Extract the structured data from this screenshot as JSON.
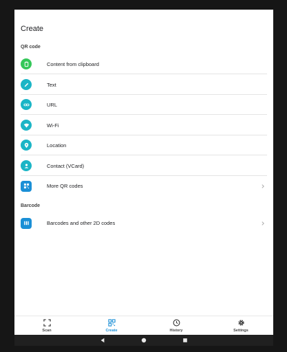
{
  "header": {
    "title": "Create"
  },
  "sections": {
    "qr_label": "QR code",
    "barcode_label": "Barcode"
  },
  "qr_items": [
    {
      "label": "Content from clipboard",
      "icon": "clipboard-icon",
      "color": "#34c759"
    },
    {
      "label": "Text",
      "icon": "pencil-icon",
      "color": "#1bb5c6"
    },
    {
      "label": "URL",
      "icon": "link-icon",
      "color": "#1bb5c6"
    },
    {
      "label": "Wi-Fi",
      "icon": "wifi-icon",
      "color": "#1bb5c6"
    },
    {
      "label": "Location",
      "icon": "location-pin-icon",
      "color": "#1bb5c6"
    },
    {
      "label": "Contact (VCard)",
      "icon": "person-icon",
      "color": "#1bb5c6"
    },
    {
      "label": "More QR codes",
      "icon": "qr-icon",
      "color": "#1a8fd6"
    }
  ],
  "barcode_items": [
    {
      "label": "Barcodes and other 2D codes",
      "icon": "barcode-icon",
      "color": "#1a8fd6"
    }
  ],
  "bottom_nav": [
    {
      "label": "Scan",
      "icon": "scan-icon"
    },
    {
      "label": "Create",
      "icon": "qr-icon",
      "active": true
    },
    {
      "label": "History",
      "icon": "clock-icon"
    },
    {
      "label": "Settings",
      "icon": "gear-icon"
    }
  ],
  "system_nav": [
    "back-icon",
    "home-icon",
    "recents-icon"
  ]
}
